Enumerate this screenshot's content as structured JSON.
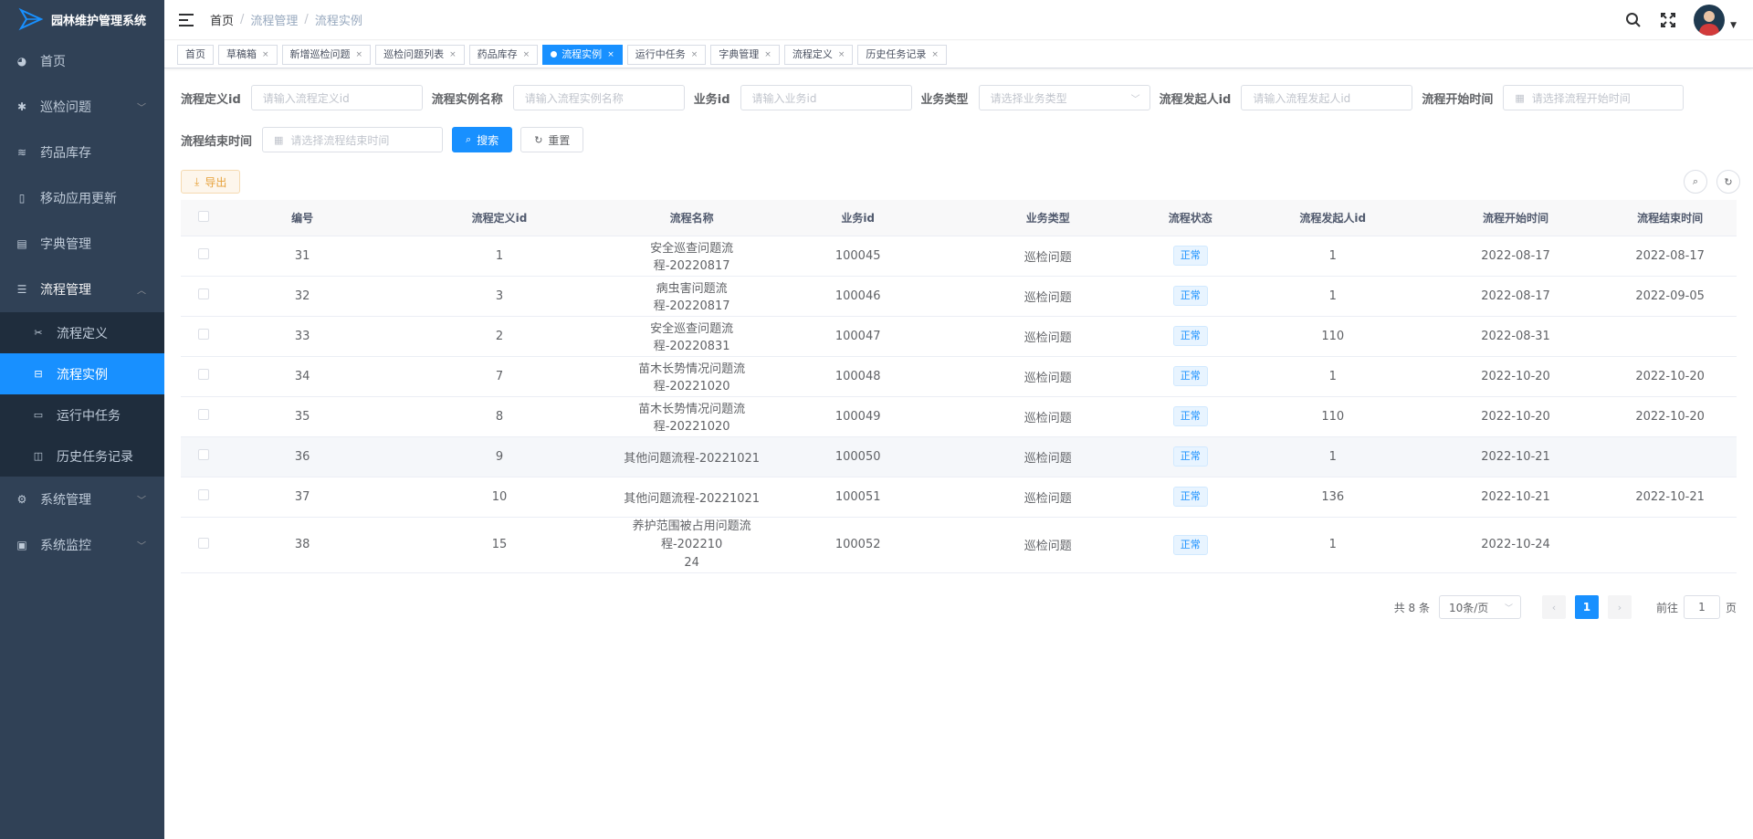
{
  "app": {
    "title": "园林维护管理系统"
  },
  "sidebar": {
    "items": [
      {
        "label": "首页",
        "icon": "dashboard-icon"
      },
      {
        "label": "巡检问题",
        "icon": "bug-icon",
        "has_arrow": true
      },
      {
        "label": "药品库存",
        "icon": "layers-icon"
      },
      {
        "label": "移动应用更新",
        "icon": "phone-icon"
      },
      {
        "label": "字典管理",
        "icon": "dict-icon"
      },
      {
        "label": "流程管理",
        "icon": "list-icon",
        "expanded": true
      }
    ],
    "sub_items": [
      {
        "label": "流程定义",
        "icon": "tool-icon"
      },
      {
        "label": "流程实例",
        "icon": "lock-icon",
        "active": true
      },
      {
        "label": "运行中任务",
        "icon": "tasks-icon"
      },
      {
        "label": "历史任务记录",
        "icon": "history-icon"
      }
    ],
    "bottom_items": [
      {
        "label": "系统管理",
        "icon": "gear-icon"
      },
      {
        "label": "系统监控",
        "icon": "monitor-icon"
      }
    ]
  },
  "breadcrumb": [
    "首页",
    "流程管理",
    "流程实例"
  ],
  "tags": [
    {
      "label": "首页",
      "closable": false
    },
    {
      "label": "草稿箱",
      "closable": true
    },
    {
      "label": "新增巡检问题",
      "closable": true
    },
    {
      "label": "巡检问题列表",
      "closable": true
    },
    {
      "label": "药品库存",
      "closable": true
    },
    {
      "label": "流程实例",
      "closable": true,
      "active": true
    },
    {
      "label": "运行中任务",
      "closable": true
    },
    {
      "label": "字典管理",
      "closable": true
    },
    {
      "label": "流程定义",
      "closable": true
    },
    {
      "label": "历史任务记录",
      "closable": true
    }
  ],
  "form": {
    "def_id_label": "流程定义id",
    "def_id_placeholder": "请输入流程定义id",
    "inst_name_label": "流程实例名称",
    "inst_name_placeholder": "请输入流程实例名称",
    "biz_id_label": "业务id",
    "biz_id_placeholder": "请输入业务id",
    "biz_type_label": "业务类型",
    "biz_type_placeholder": "请选择业务类型",
    "starter_label": "流程发起人id",
    "starter_placeholder": "请输入流程发起人id",
    "start_time_label": "流程开始时间",
    "start_time_placeholder": "请选择流程开始时间",
    "end_time_label": "流程结束时间",
    "end_time_placeholder": "请选择流程结束时间",
    "search_btn": "搜索",
    "reset_btn": "重置"
  },
  "toolbar": {
    "export_btn": "导出"
  },
  "table": {
    "headers": [
      "编号",
      "流程定义id",
      "流程名称",
      "业务id",
      "业务类型",
      "流程状态",
      "流程发起人id",
      "流程开始时间",
      "流程结束时间"
    ],
    "rows": [
      {
        "id": "31",
        "def_id": "1",
        "name": "安全巡查问题流程-20220817",
        "biz_id": "100045",
        "biz_type": "巡检问题",
        "status": "正常",
        "starter": "1",
        "start": "2022-08-17",
        "end": "2022-08-17"
      },
      {
        "id": "32",
        "def_id": "3",
        "name": "病虫害问题流程-20220817",
        "biz_id": "100046",
        "biz_type": "巡检问题",
        "status": "正常",
        "starter": "1",
        "start": "2022-08-17",
        "end": "2022-09-05"
      },
      {
        "id": "33",
        "def_id": "2",
        "name": "安全巡查问题流程-20220831",
        "biz_id": "100047",
        "biz_type": "巡检问题",
        "status": "正常",
        "starter": "110",
        "start": "2022-08-31",
        "end": ""
      },
      {
        "id": "34",
        "def_id": "7",
        "name": "苗木长势情况问题流程-20221020",
        "biz_id": "100048",
        "biz_type": "巡检问题",
        "status": "正常",
        "starter": "1",
        "start": "2022-10-20",
        "end": "2022-10-20"
      },
      {
        "id": "35",
        "def_id": "8",
        "name": "苗木长势情况问题流程-20221020",
        "biz_id": "100049",
        "biz_type": "巡检问题",
        "status": "正常",
        "starter": "110",
        "start": "2022-10-20",
        "end": "2022-10-20"
      },
      {
        "id": "36",
        "def_id": "9",
        "name": "其他问题流程-20221021",
        "biz_id": "100050",
        "biz_type": "巡检问题",
        "status": "正常",
        "starter": "1",
        "start": "2022-10-21",
        "end": ""
      },
      {
        "id": "37",
        "def_id": "10",
        "name": "其他问题流程-20221021",
        "biz_id": "100051",
        "biz_type": "巡检问题",
        "status": "正常",
        "starter": "136",
        "start": "2022-10-21",
        "end": "2022-10-21"
      },
      {
        "id": "38",
        "def_id": "15",
        "name_line1": "养护范围被占用问题流程-202210",
        "name_line2": "24",
        "biz_id": "100052",
        "biz_type": "巡检问题",
        "status": "正常",
        "starter": "1",
        "start": "2022-10-24",
        "end": ""
      }
    ]
  },
  "pagination": {
    "total": "共 8 条",
    "page_size": "10条/页",
    "current": "1",
    "goto_label": "前往",
    "goto_value": "1",
    "page_unit": "页"
  },
  "colors": {
    "sidebar_bg": "#304156",
    "primary": "#1890ff",
    "warning": "#e6a23c"
  }
}
